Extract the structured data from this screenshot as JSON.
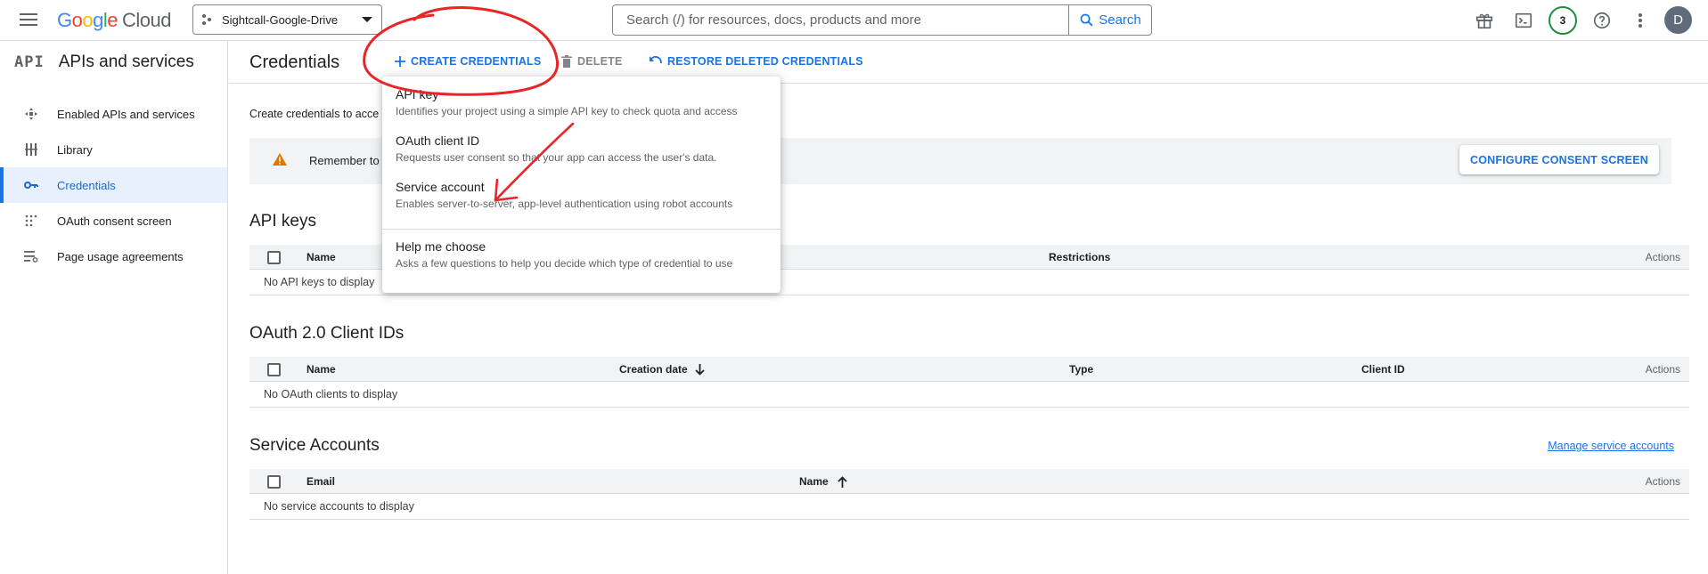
{
  "topbar": {
    "logo": {
      "G": "G",
      "o1": "o",
      "o2": "o",
      "g": "g",
      "l": "l",
      "e": "e",
      "cloud": "Cloud"
    },
    "project_name": "Sightcall-Google-Drive",
    "search_placeholder": "Search (/) for resources, docs, products and more",
    "search_button": "Search",
    "notification_count": "3",
    "avatar_initial": "D"
  },
  "sidebar": {
    "title": "APIs and services",
    "api_logo": "API",
    "items": [
      {
        "label": "Enabled APIs and services",
        "icon": "enabled-apis-icon"
      },
      {
        "label": "Library",
        "icon": "library-icon"
      },
      {
        "label": "Credentials",
        "icon": "key-icon",
        "active": true
      },
      {
        "label": "OAuth consent screen",
        "icon": "consent-icon"
      },
      {
        "label": "Page usage agreements",
        "icon": "agreements-icon"
      }
    ]
  },
  "header": {
    "title": "Credentials",
    "create_label": "CREATE CREDENTIALS",
    "delete_label": "DELETE",
    "restore_label": "RESTORE DELETED CREDENTIALS"
  },
  "intro_text": "Create credentials to acce",
  "banner": {
    "text": "Remember to",
    "button": "CONFIGURE CONSENT SCREEN"
  },
  "api_keys": {
    "title": "API keys",
    "columns": [
      "Name",
      "Restrictions",
      "Actions"
    ],
    "empty": "No API keys to display"
  },
  "oauth_clients": {
    "title": "OAuth 2.0 Client IDs",
    "columns": [
      "Name",
      "Creation date",
      "Type",
      "Client ID",
      "Actions"
    ],
    "empty": "No OAuth clients to display"
  },
  "service_accounts": {
    "title": "Service Accounts",
    "manage_link": "Manage service accounts",
    "columns": [
      "Email",
      "Name",
      "Actions"
    ],
    "empty": "No service accounts to display"
  },
  "dropdown": {
    "items": [
      {
        "title": "API key",
        "desc": "Identifies your project using a simple API key to check quota and access"
      },
      {
        "title": "OAuth client ID",
        "desc": "Requests user consent so that your app can access the user's data."
      },
      {
        "title": "Service account",
        "desc": "Enables server-to-server, app-level authentication using robot accounts"
      },
      {
        "title": "Help me choose",
        "desc": "Asks a few questions to help you decide which type of credential to use"
      }
    ]
  },
  "colors": {
    "accent": "#1a73e8",
    "annotation": "#e8262a",
    "warning": "#e37400"
  }
}
